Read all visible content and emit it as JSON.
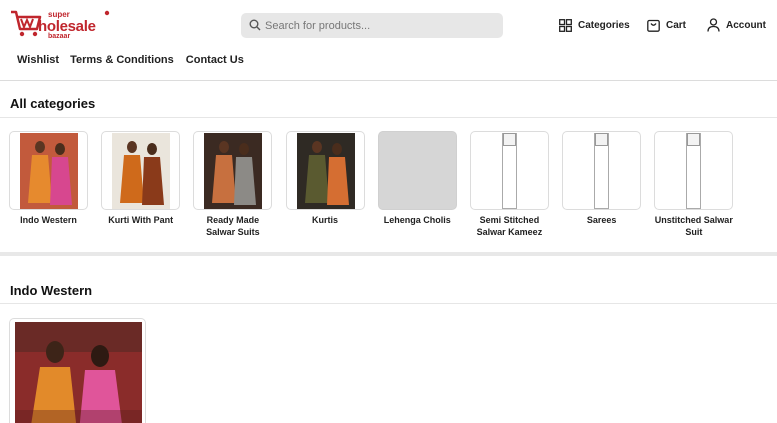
{
  "brand": {
    "line1": "super",
    "line2": "holesale",
    "line3": "bazaar",
    "color": "#c0262d",
    "cart_icon": "cart-w-logo-icon"
  },
  "search": {
    "placeholder": "Search for products..."
  },
  "header_actions": [
    {
      "label": "Categories",
      "icon": "grid-icon"
    },
    {
      "label": "Cart",
      "icon": "bag-icon"
    },
    {
      "label": "Account",
      "icon": "user-icon"
    }
  ],
  "nav": [
    "Wishlist",
    "Terms & Conditions",
    "Contact Us"
  ],
  "all_categories": {
    "title": "All categories",
    "items": [
      {
        "label": "Indo Western",
        "image": "photo",
        "colors": [
          "#c25a3c",
          "#e68a2e",
          "#d7478f"
        ]
      },
      {
        "label": "Kurti With Pant",
        "image": "photo",
        "colors": [
          "#eae5dc",
          "#cf6a1b",
          "#8a3a1a"
        ]
      },
      {
        "label": "Ready Made Salwar Suits",
        "image": "photo",
        "colors": [
          "#3b2a22",
          "#c7703f",
          "#8c8a86"
        ]
      },
      {
        "label": "Kurtis",
        "image": "photo",
        "colors": [
          "#2f2a24",
          "#5a5a30",
          "#d56e32"
        ]
      },
      {
        "label": "Lehenga Cholis",
        "image": "empty",
        "colors": []
      },
      {
        "label": "Semi Stitched Salwar Kameez",
        "image": "broken",
        "colors": []
      },
      {
        "label": "Sarees",
        "image": "broken",
        "colors": []
      },
      {
        "label": "Unstitched Salwar Suit",
        "image": "broken",
        "colors": []
      }
    ]
  },
  "section": {
    "title": "Indo Western",
    "products": [
      {
        "image": "photo",
        "colors": [
          "#8a2c2a",
          "#e28a2a",
          "#e0559a"
        ]
      }
    ]
  }
}
